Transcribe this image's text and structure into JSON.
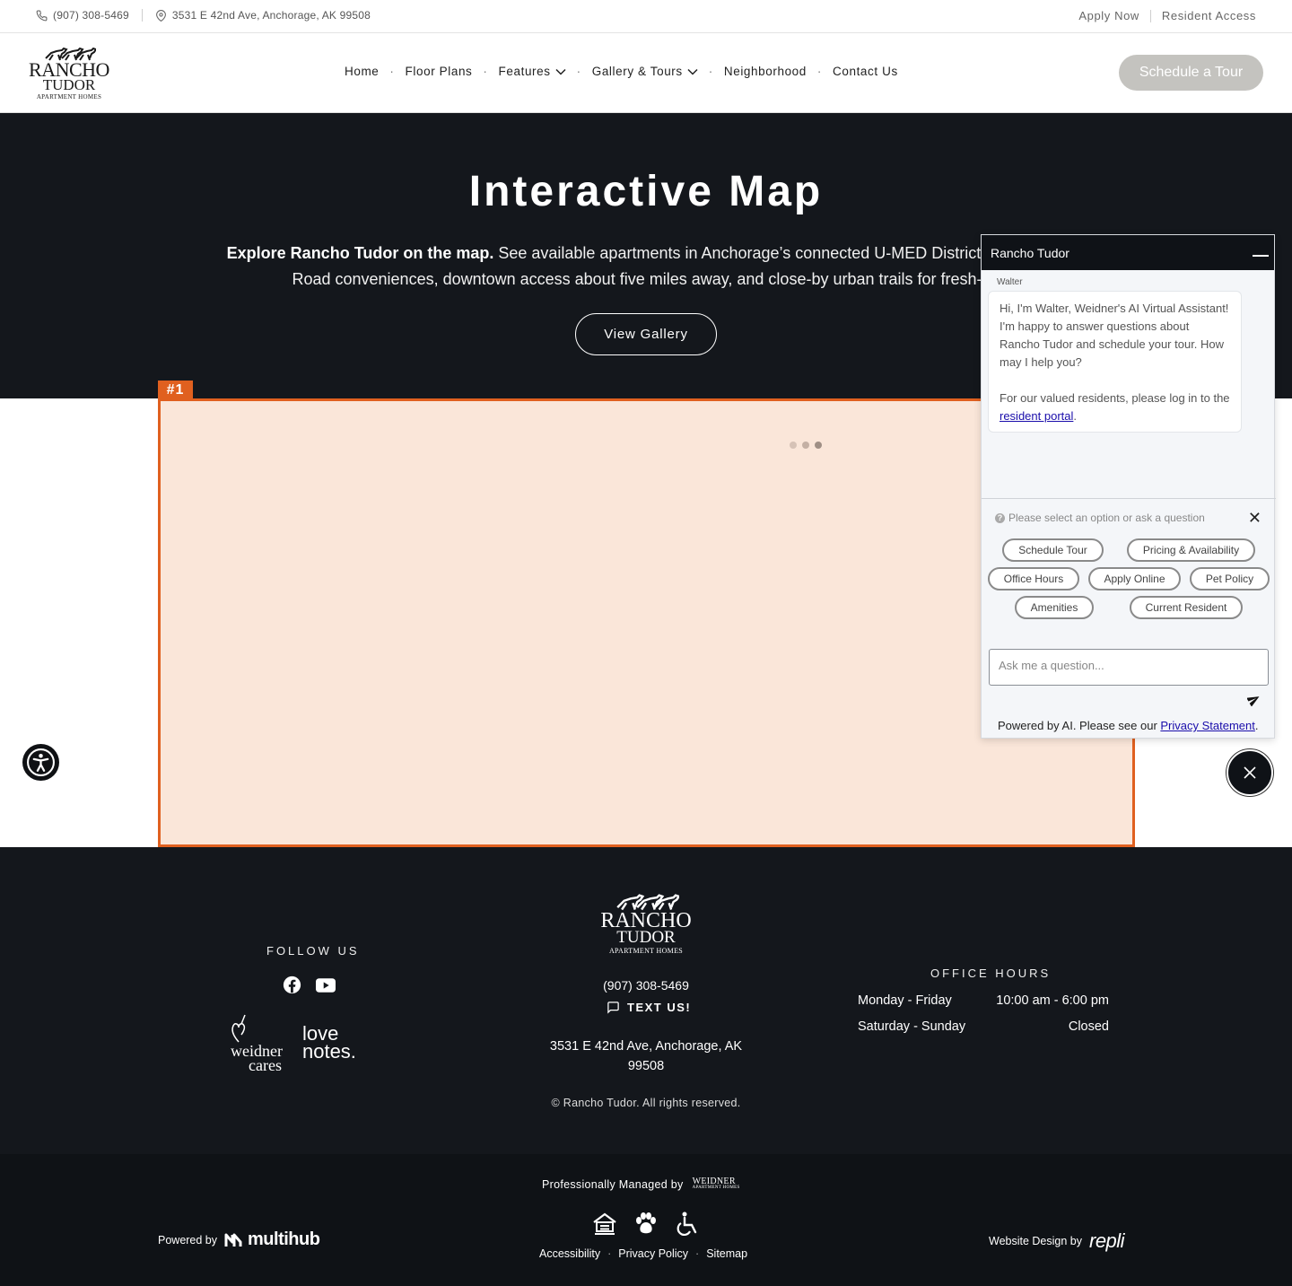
{
  "topbar": {
    "phone": "(907) 308-5469",
    "address": "3531 E 42nd Ave, Anchorage, AK 99508",
    "apply_now": "Apply Now",
    "resident_access": "Resident Access"
  },
  "header": {
    "logo": {
      "line1": "RANCHO",
      "line2": "TUDOR",
      "line3": "APARTMENT HOMES"
    },
    "nav": [
      "Home",
      "Floor Plans",
      "Features",
      "Gallery & Tours",
      "Neighborhood",
      "Contact Us"
    ],
    "schedule_tour": "Schedule a Tour"
  },
  "hero": {
    "title": "Interactive Map",
    "desc_bold": "Explore Rancho Tudor on the map.",
    "desc_line1": " See available apartments in Anchorage’s connected U-MED District, then zoom",
    "desc_line2": "Road conveniences, downtown access about five miles away, and close-by urban trails for fresh-air",
    "view_gallery": "View Gallery"
  },
  "map": {
    "tag": "#1"
  },
  "chat": {
    "title": "Rancho Tudor",
    "sender": "Walter",
    "message1": "Hi, I'm Walter, Weidner's AI Virtual Assistant! I'm happy to answer questions about Rancho Tudor and schedule your tour. How may I help you?",
    "message2_prefix": "For our valued residents, please log in to the ",
    "message2_link": "resident portal",
    "message2_suffix": ".",
    "prompt": "Please select an option or ask a question",
    "chips": [
      "Schedule Tour",
      "Pricing & Availability",
      "Office Hours",
      "Apply Online",
      "Pet Policy",
      "Amenities",
      "Current Resident"
    ],
    "input_placeholder": "Ask me a question...",
    "powered_prefix": "Powered by AI. Please see our ",
    "powered_link": "Privacy Statement",
    "powered_suffix": "."
  },
  "footer": {
    "follow_us": "FOLLOW US",
    "weidner_cares_1": "weidner",
    "weidner_cares_2": "cares",
    "love_notes_1": "love",
    "love_notes_2": "notes.",
    "logo": {
      "line1": "RANCHO",
      "line2": "TUDOR",
      "line3": "APARTMENT HOMES"
    },
    "phone": "(907) 308-5469",
    "text_us": "TEXT US!",
    "address": "3531 E 42nd Ave, Anchorage, AK 99508",
    "copyright": "© Rancho Tudor. All rights reserved.",
    "office_hours_title": "OFFICE HOURS",
    "hours": [
      {
        "days": "Monday - Friday",
        "time": "10:00 am - 6:00 pm"
      },
      {
        "days": "Saturday - Sunday",
        "time": "Closed"
      }
    ]
  },
  "bottombar": {
    "managed_by": "Professionally Managed by",
    "weidner_1": "WEIDNER",
    "weidner_2": "APARTMENT HOMES",
    "powered_by": "Powered by",
    "multihub": "multihub",
    "links": [
      "Accessibility",
      "Privacy Policy",
      "Sitemap"
    ],
    "design_by": "Website Design by",
    "repli": "repli"
  }
}
